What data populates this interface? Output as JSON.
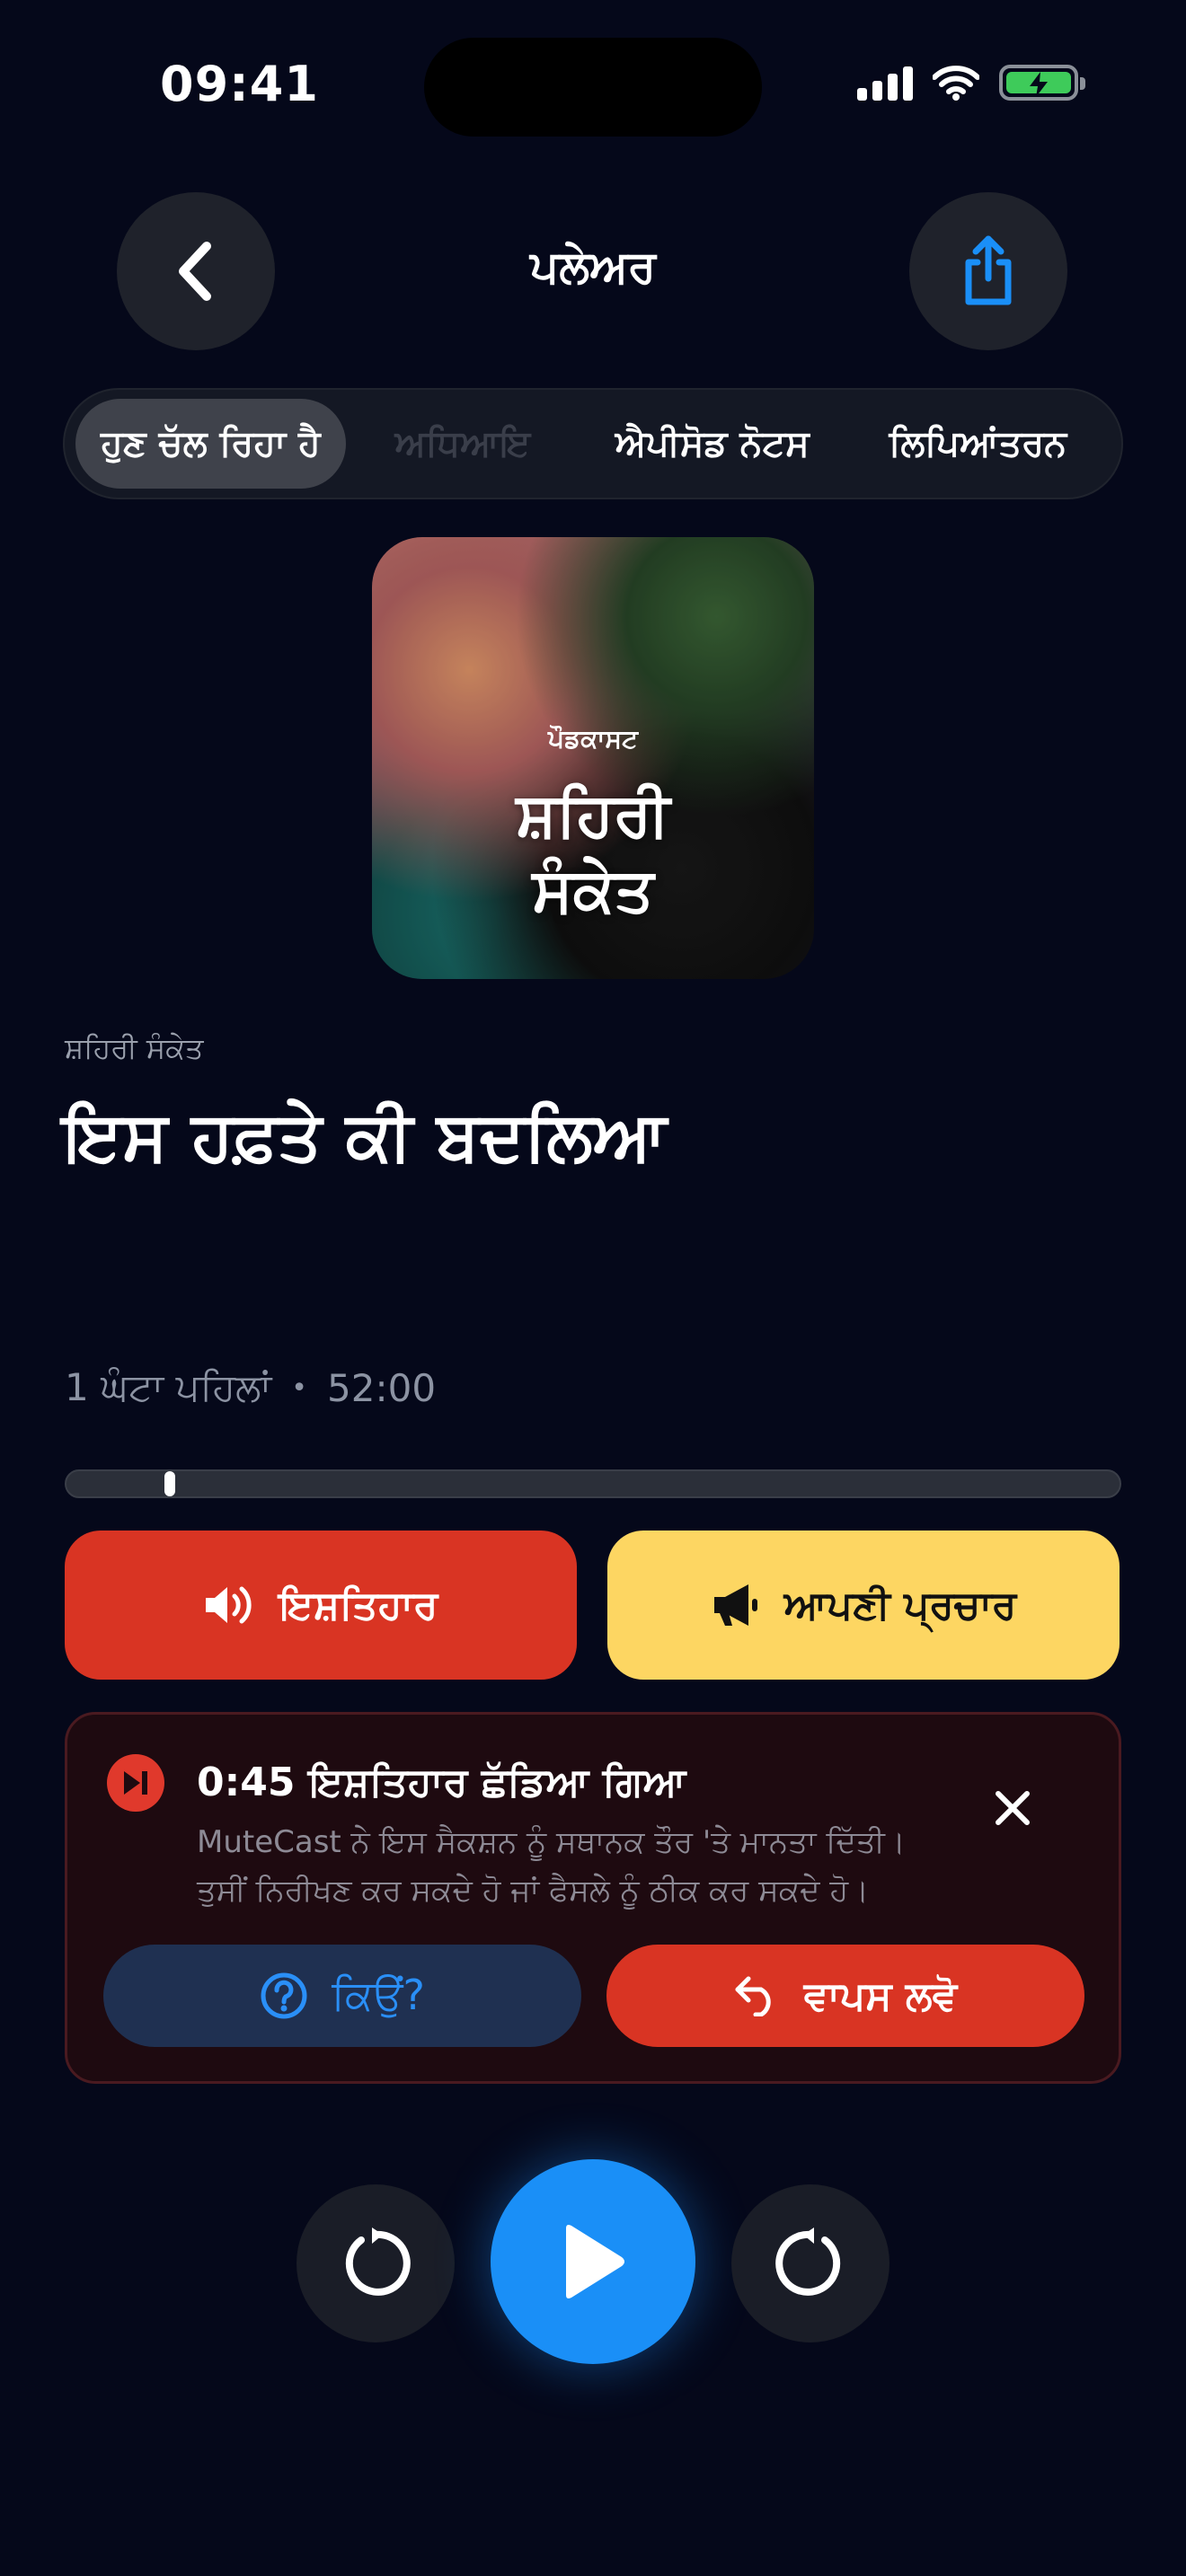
{
  "status_bar": {
    "time": "09:41"
  },
  "header": {
    "title": "ਪਲੇਅਰ"
  },
  "tabs": [
    {
      "label": "ਹੁਣ ਚੱਲ ਰਿਹਾ ਹੈ",
      "active": true
    },
    {
      "label": "ਅਧਿਆਇ",
      "active": false
    },
    {
      "label": "ਐਪੀਸੋਡ ਨੋਟਸ",
      "active": false
    },
    {
      "label": "ਲਿਪਿਆਂਤਰਨ",
      "active": false
    }
  ],
  "artwork": {
    "kicker": "ਪੌਡਕਾਸਟ",
    "title_line1": "ਸ਼ਹਿਰੀ",
    "title_line2": "ਸੰਕੇਤ"
  },
  "episode": {
    "show_name": "ਸ਼ਹਿਰੀ ਸੰਕੇਤ",
    "title": "ਇਸ ਹਫ਼ਤੇ ਕੀ ਬਦਲਿਆ",
    "age": "1 ਘੰਟਾ ਪਹਿਲਾਂ",
    "separator": "•",
    "duration": "52:00",
    "progress_fraction": 0.04
  },
  "actions": {
    "ads_label": "ਇਸ਼ਤਿਹਾਰ",
    "promo_label": "ਆਪਣੀ ਪ੍ਰਚਾਰ"
  },
  "notice": {
    "title": "0:45 ਇਸ਼ਤਿਹਾਰ ਛੱਡਿਆ ਗਿਆ",
    "line1": "MuteCast ਨੇ ਇਸ ਸੈਕਸ਼ਨ ਨੂੰ ਸਥਾਨਕ ਤੌਰ 'ਤੇ ਮਾਨਤਾ ਦਿੱਤੀ।",
    "line2": "ਤੁਸੀਂ ਨਿਰੀਖਣ ਕਰ ਸਕਦੇ ਹੋ ਜਾਂ ਫੈਸਲੇ ਨੂੰ ਠੀਕ ਕਰ ਸਕਦੇ ਹੋ।",
    "why_label": "ਕਿਉਂ?",
    "undo_label": "ਵਾਪਸ ਲਵੋ"
  },
  "colors": {
    "background": "#05081a",
    "accent_blue": "#1a8ff7",
    "ads_red": "#d93423",
    "promo_yellow": "#fdd662"
  },
  "icons": [
    "back-chevron-icon",
    "share-icon",
    "speaker-icon",
    "megaphone-icon",
    "skip-icon",
    "close-icon",
    "question-icon",
    "undo-icon",
    "rewind-icon",
    "play-icon",
    "forward-icon"
  ]
}
